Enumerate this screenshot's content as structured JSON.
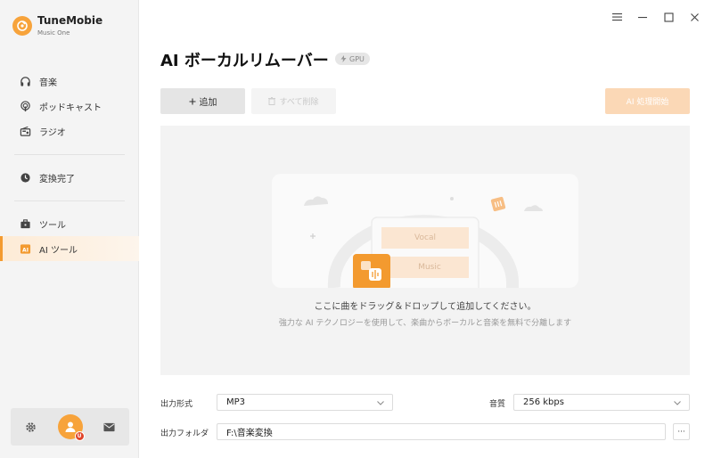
{
  "app": {
    "name": "TuneMobie",
    "subtitle": "Music One"
  },
  "sidebar": {
    "items": [
      {
        "label": "音楽",
        "icon": "headphones-icon"
      },
      {
        "label": "ポッドキャスト",
        "icon": "podcast-icon"
      },
      {
        "label": "ラジオ",
        "icon": "radio-icon"
      },
      {
        "label": "変換完了",
        "icon": "clock-icon"
      },
      {
        "label": "ツール",
        "icon": "toolbox-icon"
      },
      {
        "label": "AI ツール",
        "icon": "ai-icon",
        "active": true
      }
    ],
    "avatar_badge": "U"
  },
  "main": {
    "title": "AI ボーカルリムーバー",
    "gpu_badge": "GPU",
    "add_button": "追加",
    "delete_all_button": "すべて削除",
    "start_button": "AI 処理開始",
    "drop_main": "ここに曲をドラッグ＆ドロップして追加してください。",
    "drop_sub": "強力な AI テクノロジーを使用して、楽曲からボーカルと音楽を無料で分離します",
    "illus_vocal": "Vocal",
    "illus_music": "Music"
  },
  "settings": {
    "format_label": "出力形式",
    "format_value": "MP3",
    "quality_label": "音質",
    "quality_value": "256 kbps",
    "folder_label": "出力フォルダ",
    "folder_value": "F:\\音楽変換",
    "more_label": "···"
  },
  "colors": {
    "accent": "#f39a2f",
    "accent_light": "#fbd8b6"
  }
}
